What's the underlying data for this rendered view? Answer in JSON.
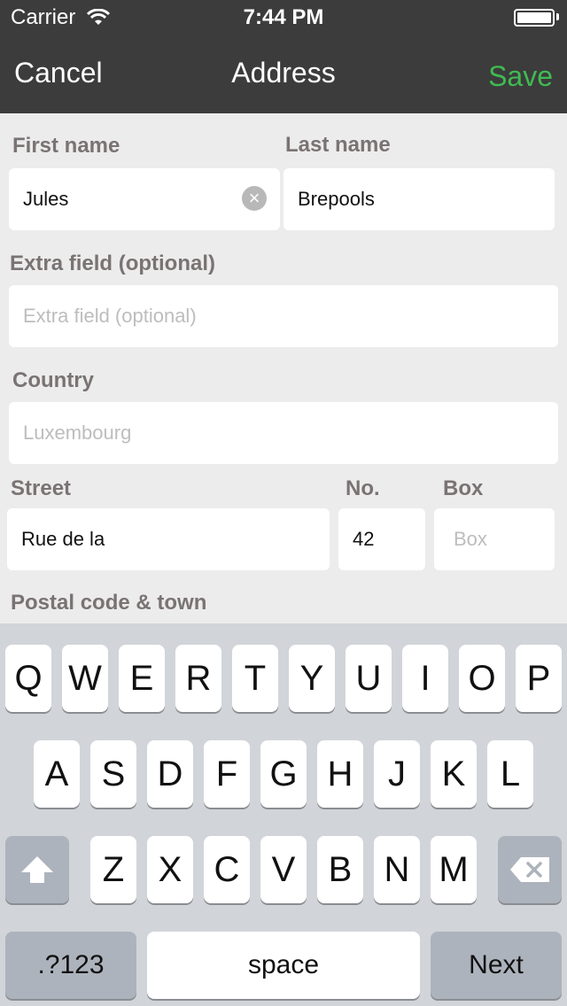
{
  "status": {
    "carrier": "Carrier",
    "time": "7:44 PM"
  },
  "nav": {
    "cancel": "Cancel",
    "title": "Address",
    "save": "Save"
  },
  "form": {
    "first_name": {
      "label": "First name",
      "value": "Jules"
    },
    "last_name": {
      "label": "Last name",
      "value": "Brepools"
    },
    "extra": {
      "label": "Extra field (optional)",
      "placeholder": "Extra field (optional)"
    },
    "country": {
      "label": "Country",
      "value": "Luxembourg"
    },
    "street": {
      "label": "Street",
      "value": "Rue de la"
    },
    "number": {
      "label": "No.",
      "value": "42"
    },
    "box": {
      "label": "Box",
      "placeholder": "Box"
    },
    "postal": {
      "label": "Postal code & town"
    }
  },
  "keyboard": {
    "row1": [
      "Q",
      "W",
      "E",
      "R",
      "T",
      "Y",
      "U",
      "I",
      "O",
      "P"
    ],
    "row2": [
      "A",
      "S",
      "D",
      "F",
      "G",
      "H",
      "J",
      "K",
      "L"
    ],
    "row3": [
      "Z",
      "X",
      "C",
      "V",
      "B",
      "N",
      "M"
    ],
    "numbers": ".?123",
    "space": "space",
    "next": "Next"
  },
  "colors": {
    "nav_bg": "#3c3c3c",
    "save_green": "#3fbb52",
    "label_gray": "#7a7373"
  }
}
